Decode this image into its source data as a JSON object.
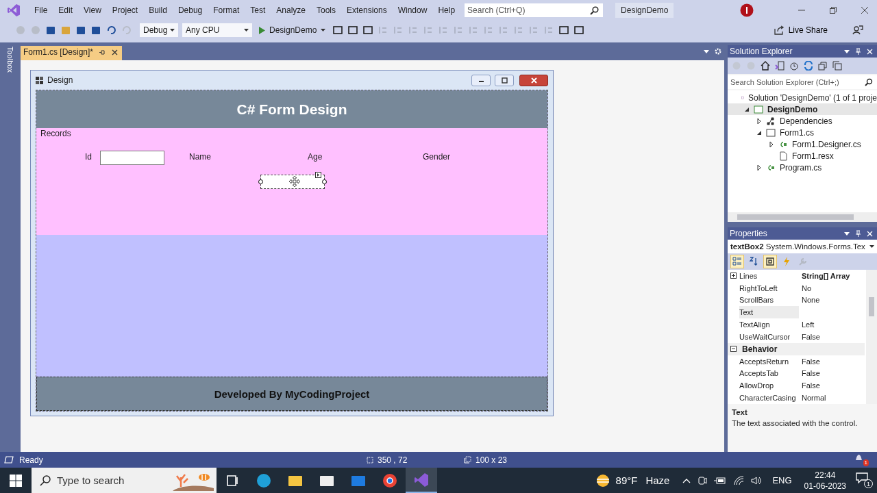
{
  "menu": {
    "items": [
      "File",
      "Edit",
      "View",
      "Project",
      "Build",
      "Debug",
      "Format",
      "Test",
      "Analyze",
      "Tools",
      "Extensions",
      "Window",
      "Help"
    ],
    "search": {
      "placeholder": "Search (Ctrl+Q)"
    },
    "solution_name": "DesignDemo"
  },
  "toolbar": {
    "configuration": "Debug",
    "platform": "Any CPU",
    "start": "DesignDemo",
    "live_share": "Live Share"
  },
  "toolbox_tab": "Toolbox",
  "document_tabs": [
    {
      "label": "Form1.cs [Design]*",
      "selected": true
    }
  ],
  "form": {
    "title": "Design",
    "header": "C# Form Design",
    "group_label": "Records",
    "labels": [
      "Id",
      "Name",
      "Age",
      "Gender"
    ],
    "textboxes": [
      {
        "selected": false
      },
      {
        "selected": true
      }
    ],
    "footer": "Developed By MyCodingProject"
  },
  "solution_explorer": {
    "title": "Solution Explorer",
    "search": {
      "placeholder": "Search Solution Explorer (Ctrl+;)"
    },
    "tree": [
      {
        "label": "Solution 'DesignDemo' (1 of 1 proje",
        "kind": "solution",
        "selected": false,
        "children": [
          {
            "label": "DesignDemo",
            "kind": "project",
            "expanded": true,
            "selected": true,
            "children": [
              {
                "label": "Dependencies",
                "kind": "dependencies",
                "expanded": false,
                "selected": false
              },
              {
                "label": "Form1.cs",
                "kind": "form",
                "expanded": true,
                "selected": false,
                "children": [
                  {
                    "label": "Form1.Designer.cs",
                    "kind": "cs",
                    "expanded": false,
                    "selected": false
                  },
                  {
                    "label": "Form1.resx",
                    "kind": "resx",
                    "selected": false
                  }
                ]
              },
              {
                "label": "Program.cs",
                "kind": "cs",
                "expanded": false,
                "selected": false
              }
            ]
          }
        ]
      }
    ]
  },
  "properties": {
    "title": "Properties",
    "object_name": "textBox2",
    "object_type": "System.Windows.Forms.Tex",
    "tools": [
      {
        "kind": "categorized",
        "selected": true
      },
      {
        "kind": "alphabetical",
        "selected": false
      },
      {
        "kind": "properties",
        "selected": true
      },
      {
        "kind": "events",
        "selected": false
      },
      {
        "kind": "pages",
        "selected": false
      }
    ],
    "rows": [
      {
        "kind": "property",
        "name": "Lines",
        "value": "String[] Array",
        "modified": true,
        "expanded": false,
        "selected": false
      },
      {
        "kind": "property",
        "name": "RightToLeft",
        "value": "No",
        "modified": false,
        "selected": false
      },
      {
        "kind": "property",
        "name": "ScrollBars",
        "value": "None",
        "modified": false,
        "selected": false
      },
      {
        "kind": "property",
        "name": "Text",
        "selected": true
      },
      {
        "kind": "property",
        "name": "TextAlign",
        "value": "Left",
        "modified": false,
        "selected": false
      },
      {
        "kind": "property",
        "name": "UseWaitCursor",
        "value": "False",
        "modified": false,
        "selected": false
      },
      {
        "kind": "category",
        "name": "Behavior",
        "expanded": true
      },
      {
        "kind": "property",
        "name": "AcceptsReturn",
        "value": "False",
        "modified": false,
        "selected": false
      },
      {
        "kind": "property",
        "name": "AcceptsTab",
        "value": "False",
        "modified": false,
        "selected": false
      },
      {
        "kind": "property",
        "name": "AllowDrop",
        "value": "False",
        "modified": false,
        "selected": false
      },
      {
        "kind": "property",
        "name": "CharacterCasing",
        "value": "Normal",
        "modified": false,
        "selected": false
      }
    ],
    "description_title": "Text",
    "description": "The text associated with the control."
  },
  "status_bar": {
    "state": "Ready",
    "position": "350 , 72",
    "size": "100 x 23",
    "notifications": "1"
  },
  "taskbar": {
    "search": {
      "placeholder": "Type to search"
    },
    "apps": [
      {
        "kind": "taskview",
        "selected": false
      },
      {
        "kind": "edge",
        "selected": false
      },
      {
        "kind": "explorer",
        "selected": false
      },
      {
        "kind": "store",
        "selected": false
      },
      {
        "kind": "mail",
        "selected": false
      },
      {
        "kind": "chrome",
        "selected": false
      },
      {
        "kind": "vs",
        "selected": true
      }
    ],
    "temperature": "89°F",
    "weather": "Haze",
    "language": "ENG",
    "time": "22:44",
    "date": "01-06-2023",
    "notifications": "1"
  }
}
